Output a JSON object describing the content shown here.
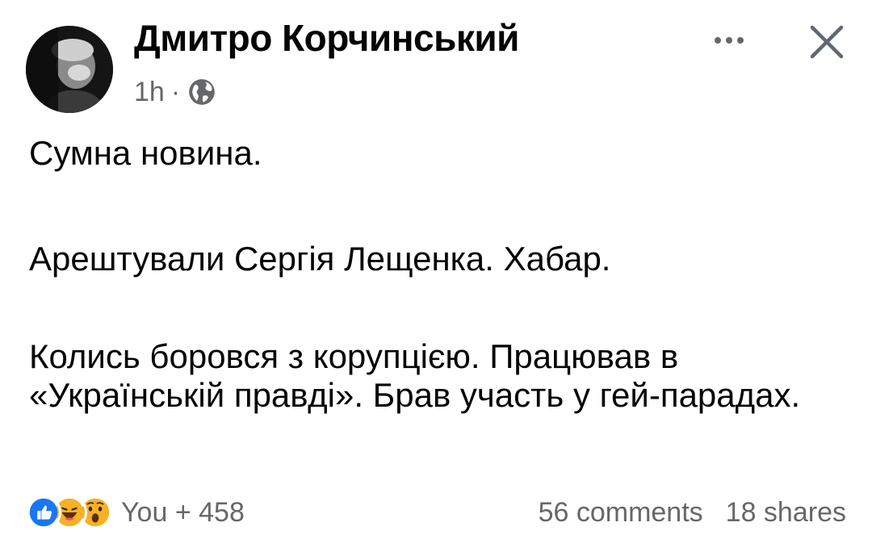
{
  "post": {
    "author": "Дмитро Корчинський",
    "time": "1h",
    "separator": "·",
    "audience_icon": "globe-icon",
    "paragraphs": [
      "Сумна новина.",
      "Арештували Сергія Лещенка. Хабар.",
      "Колись боровся з корупцією. Працював в «Українській правді». Брав участь у гей-парадах."
    ]
  },
  "header_actions": {
    "more_icon": "more-horizontal-icon",
    "close_icon": "close-icon"
  },
  "footer": {
    "reactions": [
      "like-icon",
      "haha-icon",
      "wow-icon"
    ],
    "reaction_summary": "You + 458",
    "comments": "56 comments",
    "shares": "18 shares"
  },
  "colors": {
    "text_primary": "#050505",
    "text_secondary": "#65676b",
    "like_blue": "#1877f2",
    "emoji_yellow": "#f7b125"
  }
}
